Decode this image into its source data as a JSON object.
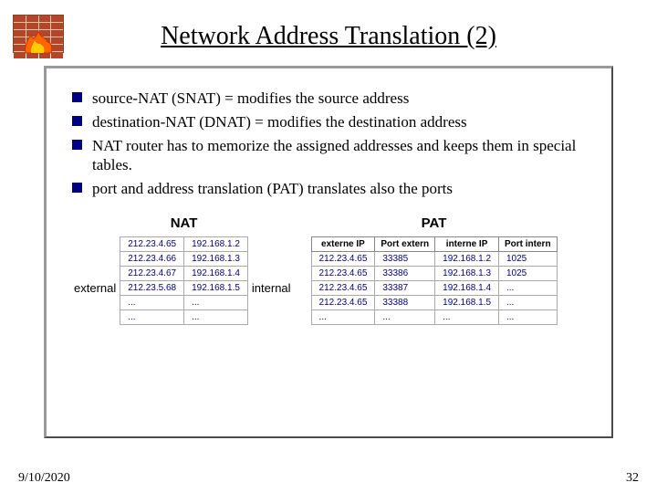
{
  "title": "Network Address Translation (2)",
  "bullets": [
    "source-NAT (SNAT) = modifies the source address",
    "destination-NAT (DNAT) = modifies the destination address",
    "NAT router has to memorize the assigned addresses and keeps them in special tables.",
    "port and address translation (PAT) translates also the ports"
  ],
  "labels": {
    "nat_title": "NAT",
    "pat_title": "PAT",
    "external": "external",
    "internal": "internal"
  },
  "nat_table": {
    "rows": [
      [
        "212.23.4.65",
        "192.168.1.2"
      ],
      [
        "212.23.4.66",
        "192.168.1.3"
      ],
      [
        "212.23.4.67",
        "192.168.1.4"
      ],
      [
        "212.23.5.68",
        "192.168.1.5"
      ],
      [
        "...",
        "..."
      ],
      [
        "...",
        "..."
      ]
    ]
  },
  "pat_table": {
    "headers": [
      "externe IP",
      "Port extern",
      "interne IP",
      "Port intern"
    ],
    "rows": [
      [
        "212.23.4.65",
        "33385",
        "192.168.1.2",
        "1025"
      ],
      [
        "212.23.4.65",
        "33386",
        "192.168.1.3",
        "1025"
      ],
      [
        "212.23.4.65",
        "33387",
        "192.168.1.4",
        "..."
      ],
      [
        "212.23.4.65",
        "33388",
        "192.168.1.5",
        "..."
      ],
      [
        "...",
        "...",
        "...",
        "..."
      ]
    ]
  },
  "footer": {
    "date": "9/10/2020",
    "page": "32"
  }
}
